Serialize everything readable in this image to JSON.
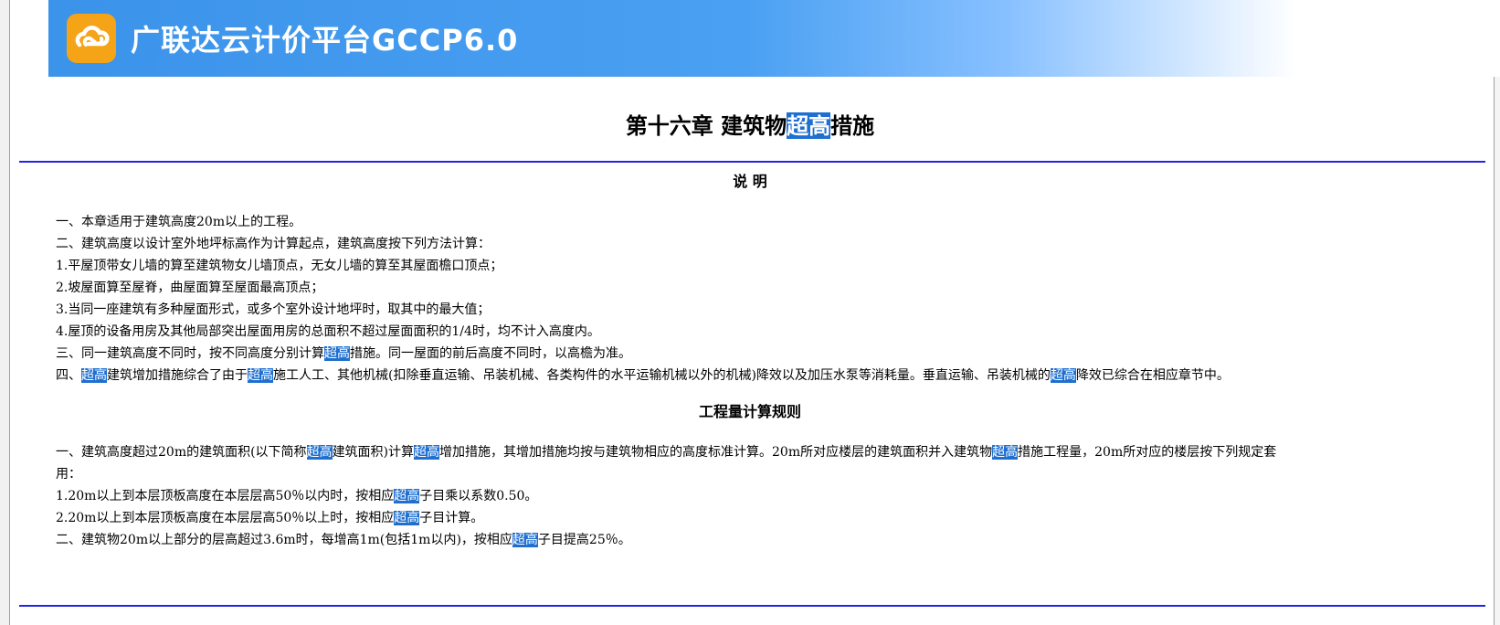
{
  "header": {
    "brand": "广联达云计价平台GCCP6.0",
    "logo_icon": "cloud-link-logo-icon",
    "colors": {
      "logo": "#f6a417",
      "banner": "#3b93ea"
    }
  },
  "chapter": {
    "title_before": "第十六章 建筑物",
    "title_highlight": "超高",
    "title_after": "措施"
  },
  "highlight_color": "#1e6fd0",
  "explanation": {
    "title": "说 明",
    "lines": [
      [
        {
          "t": "一、本章适用于建筑高度20m以上的工程。"
        }
      ],
      [
        {
          "t": "二、建筑高度以设计室外地坪标高作为计算起点，建筑高度按下列方法计算："
        }
      ],
      [
        {
          "t": "1.平屋顶带女儿墙的算至建筑物女儿墙顶点，无女儿墙的算至其屋面檐口顶点；"
        }
      ],
      [
        {
          "t": "2.坡屋面算至屋脊，曲屋面算至屋面最高顶点；"
        }
      ],
      [
        {
          "t": "3.当同一座建筑有多种屋面形式，或多个室外设计地坪时，取其中的最大值；"
        }
      ],
      [
        {
          "t": "4.屋顶的设备用房及其他局部突出屋面用房的总面积不超过屋面面积的1/4时，均不计入高度内。"
        }
      ],
      [
        {
          "t": "三、同一建筑高度不同时，按不同高度分别计算"
        },
        {
          "t": "超高",
          "hl": true
        },
        {
          "t": "措施。同一屋面的前后高度不同时，以高檐为准。"
        }
      ],
      [
        {
          "t": "四、"
        },
        {
          "t": "超高",
          "hl": true
        },
        {
          "t": "建筑增加措施综合了由于"
        },
        {
          "t": "超高",
          "hl": true
        },
        {
          "t": "施工人工、其他机械(扣除垂直运输、吊装机械、各类构件的水平运输机械以外的机械)降效以及加压水泵等消耗量。垂直运输、吊装机械的"
        },
        {
          "t": "超高",
          "hl": true
        },
        {
          "t": "降效已综合在相应章节中。"
        }
      ]
    ]
  },
  "rules": {
    "title": "工程量计算规则",
    "lines": [
      [
        {
          "t": "一、建筑高度超过20m的建筑面积(以下简称"
        },
        {
          "t": "超高",
          "hl": true
        },
        {
          "t": "建筑面积)计算"
        },
        {
          "t": "超高",
          "hl": true
        },
        {
          "t": "增加措施，其增加措施均按与建筑物相应的高度标准计算。20m所对应楼层的建筑面积并入建筑物"
        },
        {
          "t": "超高",
          "hl": true
        },
        {
          "t": "措施工程量，20m所对应的楼层按下列规定套"
        }
      ],
      [
        {
          "t": "用："
        }
      ],
      [
        {
          "t": "1.20m以上到本层顶板高度在本层层高50％以内时，按相应"
        },
        {
          "t": "超高",
          "hl": true
        },
        {
          "t": "子目乘以系数0.50。"
        }
      ],
      [
        {
          "t": "2.20m以上到本层顶板高度在本层层高50％以上时，按相应"
        },
        {
          "t": "超高",
          "hl": true
        },
        {
          "t": "子目计算。"
        }
      ],
      [
        {
          "t": "二、建筑物20m以上部分的层高超过3.6m时，每增高1m(包括1m以内)，按相应"
        },
        {
          "t": "超高",
          "hl": true
        },
        {
          "t": "子目提高25％。"
        }
      ]
    ]
  }
}
